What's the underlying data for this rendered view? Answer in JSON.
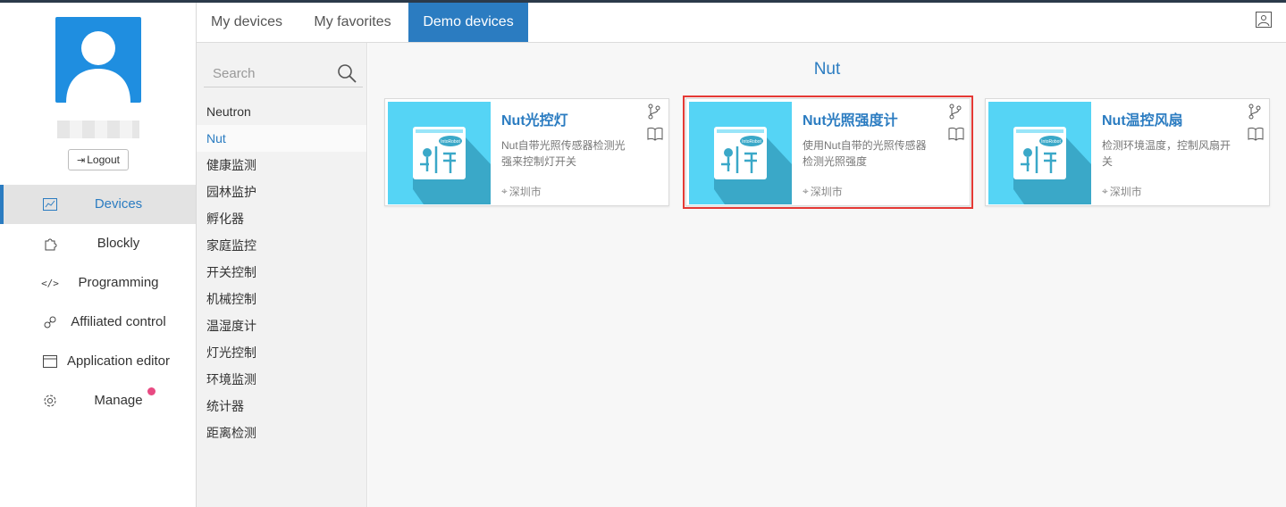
{
  "nav": {
    "logout_label": "Logout",
    "items": [
      {
        "label": "Devices",
        "icon": "chart-icon"
      },
      {
        "label": "Blockly",
        "icon": "puzzle-icon"
      },
      {
        "label": "Programming",
        "icon": "code-icon"
      },
      {
        "label": "Affiliated control",
        "icon": "link-icon"
      },
      {
        "label": "Application editor",
        "icon": "window-icon"
      },
      {
        "label": "Manage",
        "icon": "gear-icon"
      }
    ]
  },
  "tabs": [
    {
      "label": "My devices"
    },
    {
      "label": "My favorites"
    },
    {
      "label": "Demo devices"
    }
  ],
  "search": {
    "placeholder": "Search"
  },
  "categories": [
    "Neutron",
    "Nut",
    "健康监测",
    "园林监护",
    "孵化器",
    "家庭监控",
    "开关控制",
    "机械控制",
    "温湿度计",
    "灯光控制",
    "环境监测",
    "统计器",
    "距离检测"
  ],
  "section_title": "Nut",
  "cards": [
    {
      "title": "Nut光控灯",
      "desc": "Nut自带光照传感器检测光强来控制灯开关",
      "location": "深圳市"
    },
    {
      "title": "Nut光照强度计",
      "desc": "使用Nut自带的光照传感器检测光照强度",
      "location": "深圳市"
    },
    {
      "title": "Nut温控风扇",
      "desc": "检测环境温度，控制风扇开关",
      "location": "深圳市"
    }
  ],
  "thumb_label": "IntoRobot",
  "colors": {
    "accent": "#2b7cc1",
    "thumb_light": "#55d4f5",
    "thumb_dark": "#3aa8c8",
    "selected_border": "#e53935",
    "badge": "#e84a82"
  }
}
